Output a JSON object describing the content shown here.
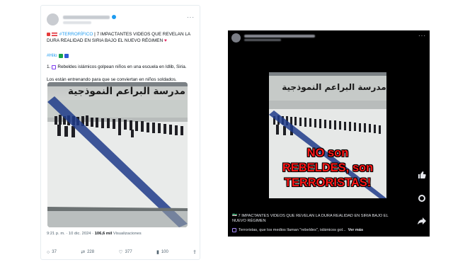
{
  "tweet": {
    "text_main": "| 7 IMPACTANTES VIDEOS QUE REVELAN LA DURA REALIDAD EN SIRIA BAJO EL NUEVO RÉGIMEN",
    "hashtag": "#TERRORÍFICO",
    "thread_marker": "#Hilo",
    "item_number": "1.",
    "item_text": "Rebeldes islámicos golpean niños en una escuela en Idlib, Siria.",
    "item_text2": "Los están entrenando para que se conviertan en niños soldados.",
    "more": "···",
    "meta_time": "9:21 p. m. · 10 dic. 2024 ·",
    "meta_views_count": "106,6 mil",
    "meta_views_label": "Visualizaciones",
    "actions": {
      "replies": "37",
      "reposts": "228",
      "likes": "377",
      "views": "100"
    },
    "school_sign": "مدرسة البراعم النموذجية"
  },
  "fb": {
    "more": "···",
    "overlay_line1": "NO son",
    "overlay_line2": "REBELDES, son",
    "overlay_line3": "TERRORISTAS!",
    "caption_line1": "7 IMPACTANTES VIDEOS QUE REVELAN LA DURA REALIDAD EN SIRIA BAJO EL",
    "caption_line1_prefix": "🇸🇾",
    "caption_line2": "NUEVO RÉGIMEN",
    "caption_line3": "Terroristas, que los medios llaman \"rebeldes\", islámicos gol...",
    "see_more": "Ver más",
    "school_sign": "مدرسة البراعم النموذجية"
  },
  "icons": [
    "reply-icon",
    "repost-icon",
    "like-icon",
    "views-icon",
    "share-icon",
    "like-fb-icon",
    "comment-fb-icon",
    "share-fb-icon"
  ]
}
